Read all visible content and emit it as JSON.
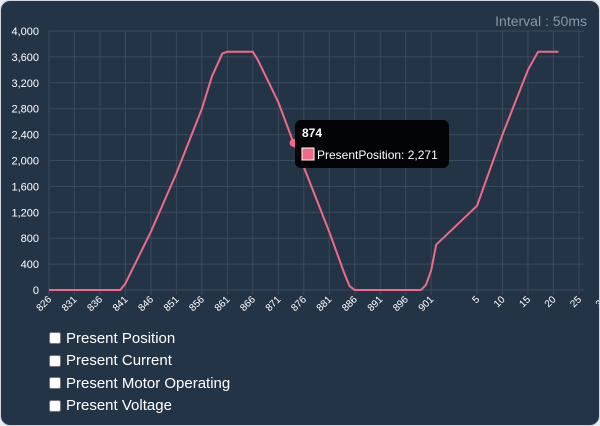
{
  "interval_label": "Interval : 50ms",
  "toggles": [
    {
      "label": "Present Position",
      "checked": false
    },
    {
      "label": "Present Current",
      "checked": false
    },
    {
      "label": "Present Motor Operating",
      "checked": false
    },
    {
      "label": "Present Voltage",
      "checked": false
    }
  ],
  "colors": {
    "background": "#243447",
    "grid": "#3b4b5e",
    "series": "#f06a87",
    "tick_text": "#ffffff",
    "tooltip_bg": "#000000"
  },
  "tooltip": {
    "title": "874",
    "text": "PresentPosition: 2,271",
    "x": "874",
    "y": 2271
  },
  "chart_data": {
    "type": "line",
    "title": "",
    "xlabel": "",
    "ylabel": "",
    "ylim": [
      0,
      4000
    ],
    "grid": true,
    "x_tick_labels": [
      "826",
      "831",
      "836",
      "841",
      "846",
      "851",
      "856",
      "861",
      "866",
      "871",
      "876",
      "881",
      "886",
      "891",
      "896",
      "901",
      "5",
      "10",
      "15",
      "20",
      "25",
      "30"
    ],
    "y_ticks": [
      0,
      400,
      800,
      1200,
      1600,
      2000,
      2400,
      2800,
      3200,
      3600,
      4000
    ],
    "y_tick_labels": [
      "0",
      "400",
      "800",
      "1,200",
      "1,600",
      "2,000",
      "2,400",
      "2,800",
      "3,200",
      "3,600",
      "4,000"
    ],
    "series": [
      {
        "points": [
          [
            "826",
            0
          ],
          [
            "831",
            0
          ],
          [
            "836",
            0
          ],
          [
            "840",
            0
          ],
          [
            "841",
            100
          ],
          [
            "846",
            900
          ],
          [
            "851",
            1800
          ],
          [
            "856",
            2800
          ],
          [
            "858",
            3300
          ],
          [
            "860",
            3650
          ],
          [
            "861",
            3680
          ],
          [
            "866",
            3680
          ],
          [
            "867",
            3550
          ],
          [
            "871",
            2900
          ],
          [
            "874",
            2271
          ],
          [
            "876",
            1900
          ],
          [
            "881",
            900
          ],
          [
            "884",
            250
          ],
          [
            "885",
            60
          ],
          [
            "886",
            0
          ],
          [
            "891",
            0
          ],
          [
            "896",
            0
          ],
          [
            "899",
            0
          ],
          [
            "900",
            80
          ],
          [
            "901",
            300
          ],
          [
            "902",
            700
          ],
          [
            "5",
            1300
          ],
          [
            "10",
            2400
          ],
          [
            "15",
            3400
          ],
          [
            "17",
            3680
          ],
          [
            "20",
            3680
          ],
          [
            "21",
            3680
          ]
        ]
      }
    ]
  }
}
